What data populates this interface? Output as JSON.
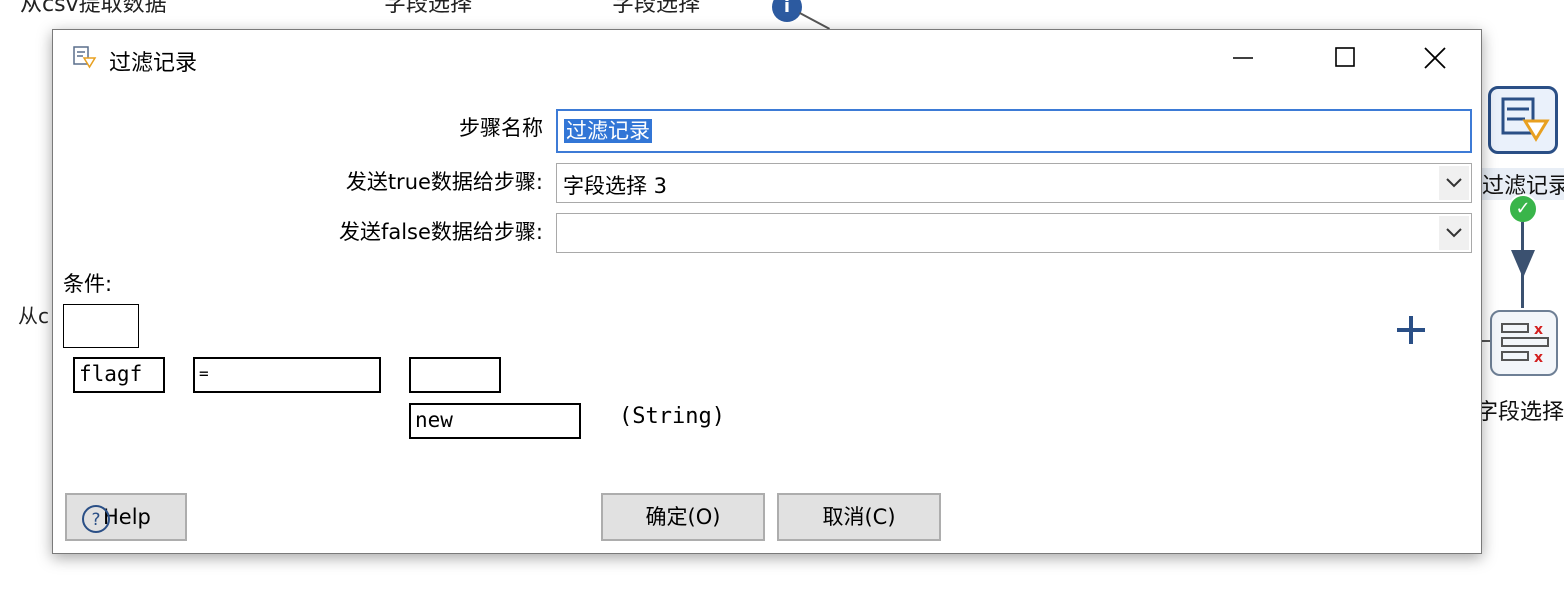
{
  "background": {
    "top_texts": [
      "从csv提取数据",
      "字段选择",
      "字段选择"
    ],
    "left_text": "从c",
    "info_icon": "info-icon",
    "steps": {
      "filter_label": "过滤记录",
      "select_label": "字段选择"
    }
  },
  "dialog": {
    "title": "过滤记录",
    "title_icon": "filter-rows-icon",
    "window_controls": [
      "minimize-icon",
      "maximize-icon",
      "close-icon"
    ],
    "fields": {
      "step_name_label": "步骤名称",
      "step_name_value": "过滤记录",
      "true_label": "发送true数据给步骤:",
      "true_value": "字段选择 3",
      "false_label": "发送false数据给步骤:",
      "false_value": ""
    },
    "condition": {
      "label": "条件:",
      "field": "flagf",
      "operator": "=",
      "right_field": "",
      "value": "new",
      "type": "(String)",
      "add_icon": "plus-icon"
    },
    "buttons": {
      "help": "Help",
      "ok": "确定(O)",
      "cancel": "取消(C)"
    }
  },
  "colors": {
    "selection": "#3276d6",
    "focus_border": "#3d7bd6",
    "step_border": "#2a4f86",
    "ok_check": "#39b54a"
  }
}
